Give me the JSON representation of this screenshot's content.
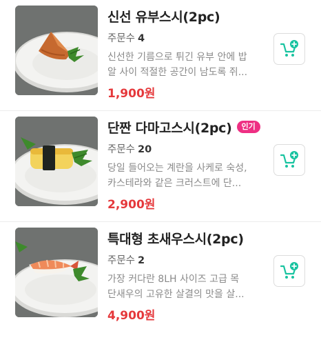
{
  "items": [
    {
      "name": "신선 유부스시(2pc)",
      "badge": "",
      "orders_label": "주문수",
      "orders_count": "4",
      "desc_line1": "신선한 기름으로 튀긴 유부 안에 밥",
      "desc_line2": "알 사이 적절한 공간이 남도록 쥐...",
      "price": "1,900원",
      "image": "inari-sushi-plate"
    },
    {
      "name": "단짠 다마고스시(2pc)",
      "badge": "인기",
      "orders_label": "주문수",
      "orders_count": "20",
      "desc_line1": "당일 들어오는 계란을 사케로 숙성,",
      "desc_line2": "카스테라와 같은 크러스트에 단...",
      "price": "2,900원",
      "image": "tamago-sushi-plate"
    },
    {
      "name": "특대형 초새우스시(2pc)",
      "badge": "",
      "orders_label": "주문수",
      "orders_count": "2",
      "desc_line1": "가장 커다란 8LH 사이즈 고급 목",
      "desc_line2": "단새우의 고유한 살결의 맛을 살...",
      "price": "4,900원",
      "image": "shrimp-sushi-plate"
    }
  ],
  "cart_icon": "add-to-cart-icon",
  "colors": {
    "price": "#e5383b",
    "badge": "#ee2f83",
    "cart_icon": "#18c3a0"
  }
}
